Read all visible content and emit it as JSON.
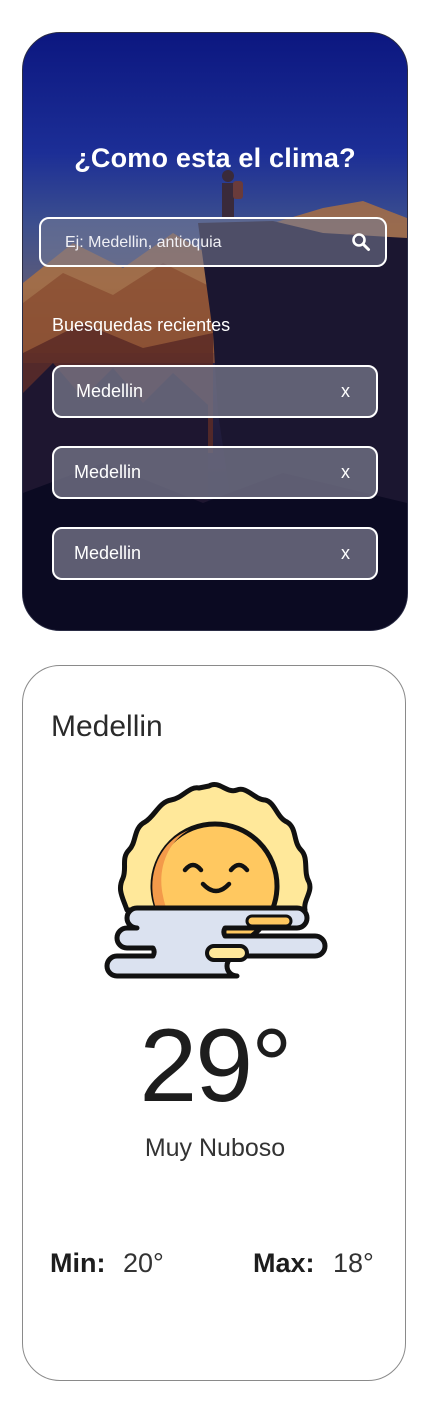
{
  "search_card": {
    "title": "¿Como esta el clima?",
    "search": {
      "placeholder": "Ej: Medellin, antioquia",
      "value": ""
    },
    "recent_heading": "Buesquedas recientes",
    "recent": [
      {
        "label": "Medellin",
        "close": "x"
      },
      {
        "label": "Medellin",
        "close": "x"
      },
      {
        "label": "Medellin",
        "close": "x"
      }
    ]
  },
  "weather": {
    "city": "Medellin",
    "icon": "sun-behind-cloud-icon",
    "temperature": "29°",
    "condition": "Muy Nuboso",
    "min_label": "Min:",
    "min_value": "20°",
    "max_label": "Max:",
    "max_value": "18°"
  }
}
